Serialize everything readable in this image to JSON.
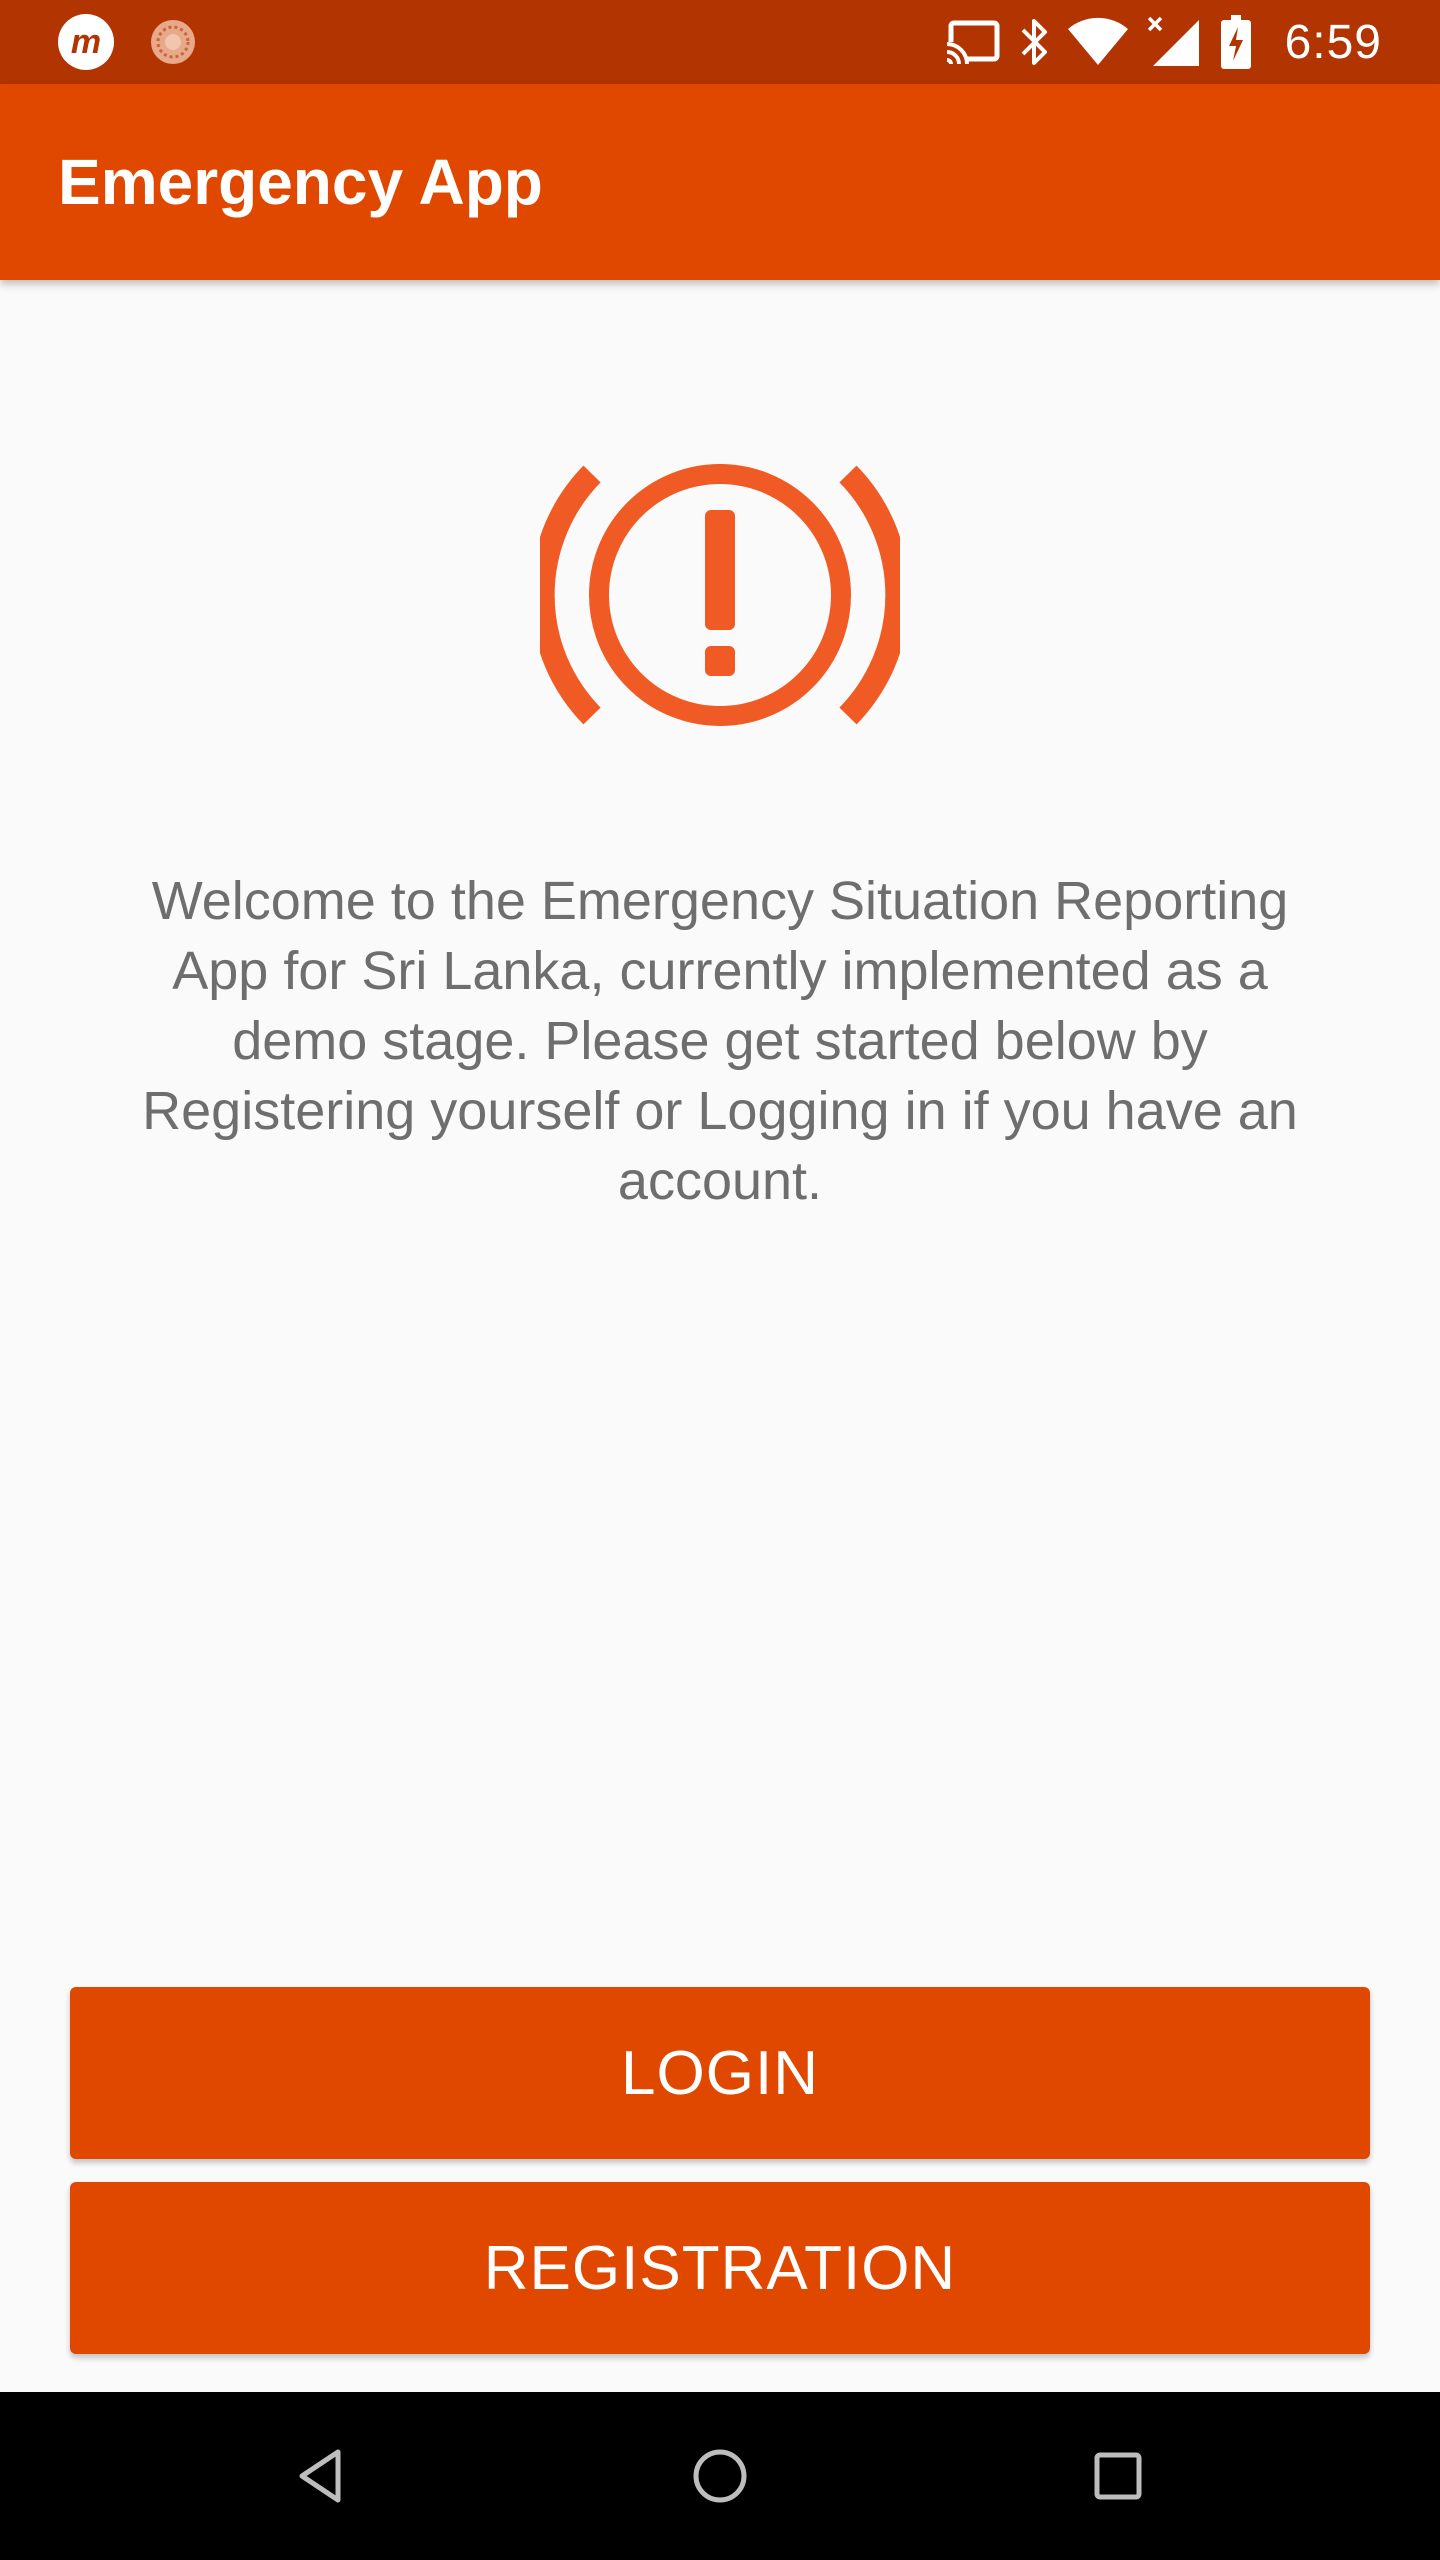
{
  "status_bar": {
    "time": "6:59",
    "notification_icons": [
      "m-app-icon",
      "loading-spinner-icon"
    ],
    "system_icons": [
      "cast-icon",
      "bluetooth-icon",
      "wifi-icon",
      "cellular-no-signal-icon",
      "battery-charging-icon"
    ]
  },
  "app_bar": {
    "title": "Emergency App"
  },
  "main": {
    "icon": "emergency-alert-icon",
    "welcome_text": "Welcome to the Emergency Situation Reporting App for Sri Lanka, currently implemented as a demo stage. Please get started below by Registering yourself or Logging in if you have an account."
  },
  "actions": {
    "login_label": "LOGIN",
    "registration_label": "REGISTRATION"
  },
  "nav_bar": {
    "buttons": [
      "back-icon",
      "home-icon",
      "recents-icon"
    ]
  },
  "colors": {
    "status_bar": "#b23400",
    "primary": "#e04800",
    "icon_accent": "#f05a24",
    "text_secondary": "#6e6e6e",
    "background": "#fafafa"
  }
}
